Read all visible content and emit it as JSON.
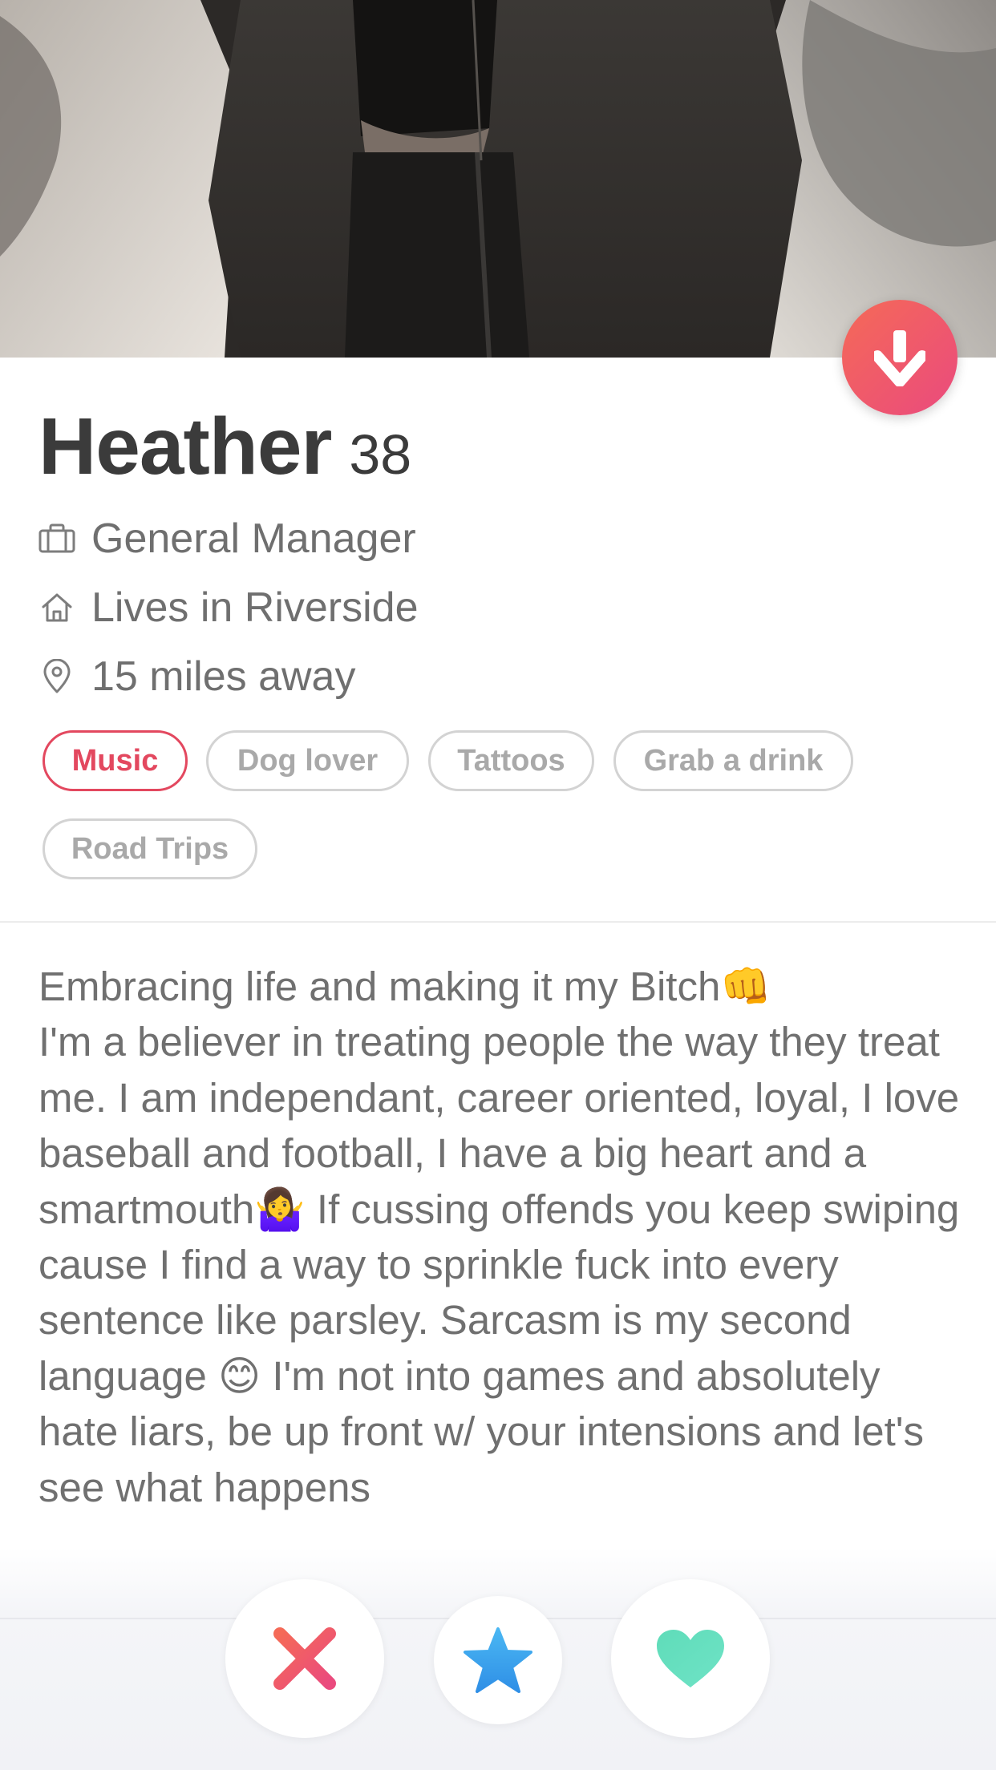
{
  "profile": {
    "name": "Heather",
    "age": "38",
    "job": "General Manager",
    "residence": "Lives in Riverside",
    "distance": "15 miles away"
  },
  "interests": [
    "Music",
    "Dog lover",
    "Tattoos",
    "Grab a drink",
    "Road Trips"
  ],
  "bio": "Embracing life and making it my Bitch👊\nI'm a believer in treating people the way they treat me. I am independant, career oriented, loyal, I love baseball and football, I have a big heart and a smartmouth🤷‍♀️ If cussing offends you keep swiping cause I find a way to sprinkle fuck into every sentence like parsley. Sarcasm is my second language 😊 I'm not into games and absolutely hate liars, be up front w/ your intensions and let's see what happens",
  "icons": {
    "collapse": "arrow-down-icon",
    "job": "briefcase-icon",
    "residence": "home-icon",
    "distance": "location-pin-icon",
    "nope": "close-x-icon",
    "super_like": "star-icon",
    "like": "heart-icon"
  },
  "colors": {
    "brand_gradient_start": "#f56a57",
    "brand_gradient_end": "#ea4a7e",
    "active_chip": "#e3485f",
    "super_like": "#3aa6ee",
    "like": "#5fdcb9"
  }
}
